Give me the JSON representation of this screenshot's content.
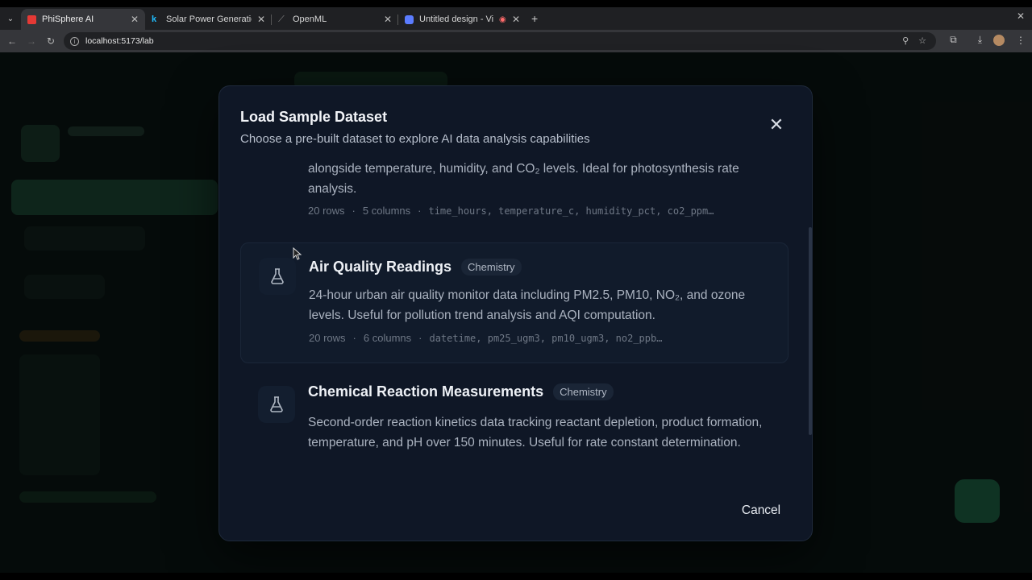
{
  "browser": {
    "tabs": [
      {
        "title": "PhiSphere AI",
        "favicon_color": "#e53935",
        "active": true
      },
      {
        "title": "Solar Power Generation",
        "favicon_color": "#20beff",
        "active": false
      },
      {
        "title": "OpenML",
        "favicon_color": "#3a3a3a",
        "active": false
      },
      {
        "title": "Untitled design - Vide",
        "favicon_color": "#7d5cff",
        "active": false
      }
    ],
    "url": "localhost:5173/lab"
  },
  "modal": {
    "title": "Load Sample Dataset",
    "subtitle": "Choose a pre-built dataset to explore AI data analysis capabilities",
    "close_icon": "close-icon",
    "cancel_label": "Cancel",
    "cards": [
      {
        "name": "",
        "badge": "",
        "description": "alongside temperature, humidity, and CO₂ levels. Ideal for photosynthesis rate analysis.",
        "rows": "20 rows",
        "columns": "5 columns",
        "fields": "time_hours, temperature_c, humidity_pct, co2_ppm…",
        "icon": "flask-icon"
      },
      {
        "name": "Air Quality Readings",
        "badge": "Chemistry",
        "description": "24-hour urban air quality monitor data including PM2.5, PM10, NO₂, and ozone levels. Useful for pollution trend analysis and AQI computation.",
        "rows": "20 rows",
        "columns": "6 columns",
        "fields": "datetime, pm25_ugm3, pm10_ugm3, no2_ppb…",
        "icon": "flask-icon"
      },
      {
        "name": "Chemical Reaction Measurements",
        "badge": "Chemistry",
        "description": "Second-order reaction kinetics data tracking reactant depletion, product formation, temperature, and pH over 150 minutes. Useful for rate constant determination.",
        "icon": "flask-icon"
      }
    ]
  },
  "colors": {
    "modal_bg": "#0f1726",
    "page_bg": "#0a1210",
    "accent_green": "#1e6b47"
  }
}
